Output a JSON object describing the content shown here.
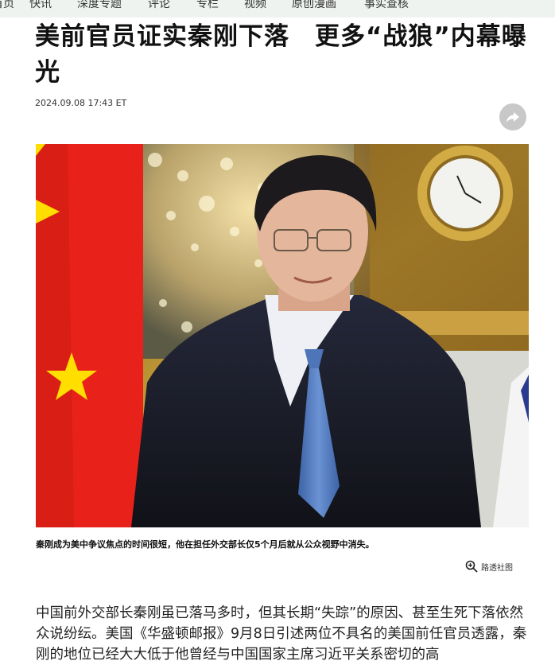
{
  "nav": {
    "items": [
      "首页",
      "快讯",
      "深度专题",
      "评论",
      "专栏",
      "视频",
      "原创漫画",
      "事实查核"
    ]
  },
  "article": {
    "headline": "美前官员证实秦刚下落　更多“战狼”内幕曝光",
    "timestamp": "2024.09.08 17:43 ET",
    "share_icon": "share-arrow-icon",
    "caption": "秦刚成为美中争议焦点的时间很短，他在担任外交部长仅5个月后就从公众视野中消失。",
    "credit": "路透社图",
    "credit_icon": "zoom-in-icon",
    "body": "中国前外交部长秦刚虽已落马多时，但其长期“失踪”的原因、甚至生死下落依然众说纷纭。美国《华盛顿邮报》9月8日引述两位不具名的美国前任官员透露，秦刚的地位已经大大低于他曾经与中国国家主席习近平关系密切的高"
  },
  "colors": {
    "nav_bg": "#eef3ef",
    "flag_red": "#e8221a",
    "flag_star": "#ffde00",
    "gold": "#c9a23a",
    "suit": "#1b1d26",
    "tie": "#4d75b8"
  }
}
